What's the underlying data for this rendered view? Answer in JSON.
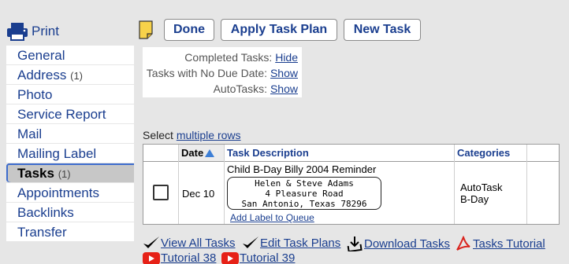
{
  "sidebar": {
    "print_label": "Print",
    "items": [
      {
        "label": "General",
        "count": ""
      },
      {
        "label": "Address",
        "count": "(1)"
      },
      {
        "label": "Photo",
        "count": ""
      },
      {
        "label": "Service Report",
        "count": ""
      },
      {
        "label": "Mail",
        "count": ""
      },
      {
        "label": "Mailing Label",
        "count": ""
      },
      {
        "label": "Tasks",
        "count": "(1)",
        "active": true
      },
      {
        "label": "Appointments",
        "count": ""
      },
      {
        "label": "Backlinks",
        "count": ""
      },
      {
        "label": "Transfer",
        "count": ""
      }
    ]
  },
  "toolbar": {
    "done_label": "Done",
    "apply_label": "Apply Task Plan",
    "new_label": "New Task"
  },
  "filters": {
    "completed_label": "Completed Tasks:",
    "completed_link": "Hide",
    "nodue_label": "Tasks with No Due Date:",
    "nodue_link": "Show",
    "auto_label": "AutoTasks:",
    "auto_link": "Show"
  },
  "select": {
    "prefix": "Select",
    "link": "multiple rows"
  },
  "table": {
    "headers": {
      "date": "Date",
      "desc": "Task Description",
      "cat": "Categories"
    },
    "rows": [
      {
        "date": "Dec 10",
        "description": "Child B-Day Billy 2004 Reminder",
        "address_lines": [
          "Helen & Steve Adams",
          "4 Pleasure Road",
          "San Antonio, Texas 78296"
        ],
        "add_label": "Add Label to Queue",
        "categories": [
          "AutoTask",
          "B-Day"
        ]
      }
    ]
  },
  "links": {
    "view_all": "View All Tasks",
    "edit_plans": "Edit Task Plans",
    "download": "Download Tasks",
    "tutorial": "Tasks Tutorial",
    "tutorial38": "Tutorial 38",
    "tutorial39": "Tutorial 39"
  },
  "colors": {
    "link": "#1a3e8f",
    "accent": "#3d6ccd",
    "youtube": "#e62117",
    "pdf": "#d9231d"
  }
}
